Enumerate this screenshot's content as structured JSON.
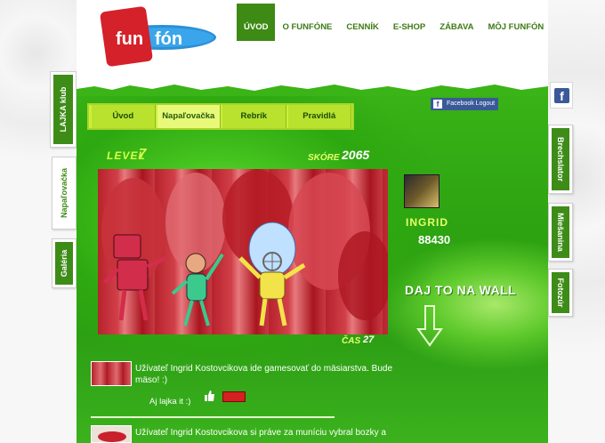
{
  "brand": {
    "logo_text": "funfón",
    "colors": {
      "red": "#d4212a",
      "blue": "#2c8fd6",
      "green": "#3d8a14",
      "lime": "#c9ef3a"
    }
  },
  "nav": {
    "items": [
      "ÚVOD",
      "O FUNFÓNE",
      "CENNÍK",
      "E-SHOP",
      "ZÁBAVA",
      "MÔJ FUNFÓN"
    ],
    "active": "ÚVOD"
  },
  "left_tabs": {
    "lajka": "LAJKA klub",
    "napalovacka": "Napaľovačka",
    "galeria": "Galéria"
  },
  "right_tabs": {
    "brechslator": "Brechslator",
    "miesanina": "Miešanina",
    "fotozur": "Fotozúr"
  },
  "game": {
    "tabs": [
      "Úvod",
      "Napaľovačka",
      "Rebrík",
      "Pravidlá"
    ],
    "active_tab": "Napaľovačka",
    "facebook_logout": "Facebook Logout",
    "level_label": "LEVEL",
    "level": "7",
    "score_label": "SKÓRE",
    "score": "2065",
    "player_name": "INGRID",
    "player_score": "88430",
    "wall_button": "DAJ TO NA WALL",
    "time_label": "ČAS",
    "time": "27"
  },
  "feed": [
    {
      "text": "Užívateľ Ingrid Kostovcikova ide gamesovať do mäsiarstva. Bude mäso! :)",
      "likes": "Aj lajka it :)"
    },
    {
      "text": "Užívateľ Ingrid Kostovcikova si práve za muníciu vybral bozky a"
    }
  ]
}
